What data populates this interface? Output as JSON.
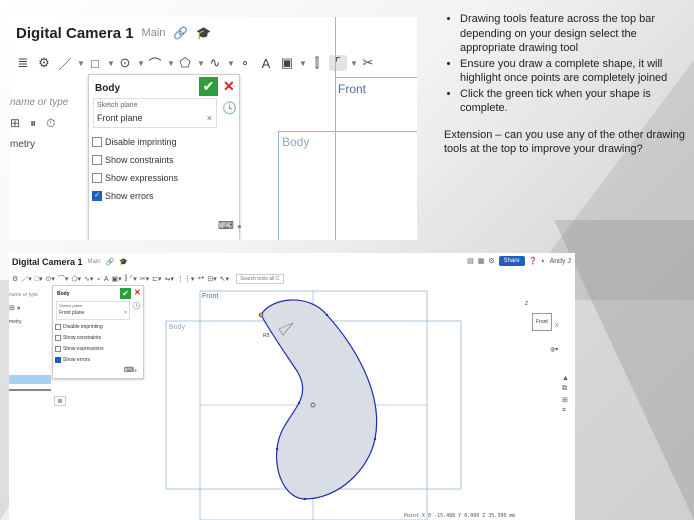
{
  "top_shot": {
    "doc_title": "Digital Camera 1",
    "branch": "Main",
    "filter_placeholder": "name or type",
    "tree_label": "metry",
    "panel": {
      "title": "Body",
      "ok_glyph": "✔",
      "cancel_glyph": "✕",
      "plane_label": "Sketch plane",
      "plane_value": "Front plane",
      "plane_clear": "×",
      "options": [
        {
          "label": "Disable imprinting",
          "checked": false
        },
        {
          "label": "Show constraints",
          "checked": false
        },
        {
          "label": "Show expressions",
          "checked": false
        },
        {
          "label": "Show errors",
          "checked": true
        }
      ]
    },
    "planes": {
      "front": "Front",
      "body": "Body"
    }
  },
  "notes": {
    "bullets": [
      "Drawing tools feature across the top bar depending on your design select the appropriate drawing tool",
      "Ensure you draw a complete shape, it will highlight once points are completely joined",
      "Click the green tick when your shape is complete."
    ],
    "extension": "Extension – can you use any of the other drawing tools at the top to improve your drawing?"
  },
  "bottom_shot": {
    "doc_title": "Digital Camera 1",
    "branch": "Main",
    "share_label": "Share",
    "user_label": "Andy J",
    "search_tools": "Search tools",
    "search_shortcut": "alt C",
    "filter_placeholder": "name or type",
    "tree_label": "metry",
    "panel": {
      "title": "Body",
      "ok_glyph": "✔",
      "cancel_glyph": "✕",
      "plane_label": "Sketch plane",
      "plane_value": "Front plane",
      "plane_clear": "×",
      "options": [
        {
          "label": "Disable imprinting",
          "checked": false
        },
        {
          "label": "Show constraints",
          "checked": false
        },
        {
          "label": "Show expressions",
          "checked": false
        },
        {
          "label": "Show errors",
          "checked": true
        }
      ]
    },
    "planes": {
      "front": "Front",
      "body": "Body"
    },
    "radius_label": "R5",
    "viewcube": {
      "face": "Front",
      "z": "Z",
      "x": "X"
    },
    "status": "Point  X 0 -15.488  Y 0.000  Z 35.390 mm"
  },
  "colors": {
    "accent": "#1f5fbf",
    "ok_green": "#2e9e3d",
    "cancel_red": "#dd2222",
    "sketch_blue": "#1a2fa8"
  }
}
